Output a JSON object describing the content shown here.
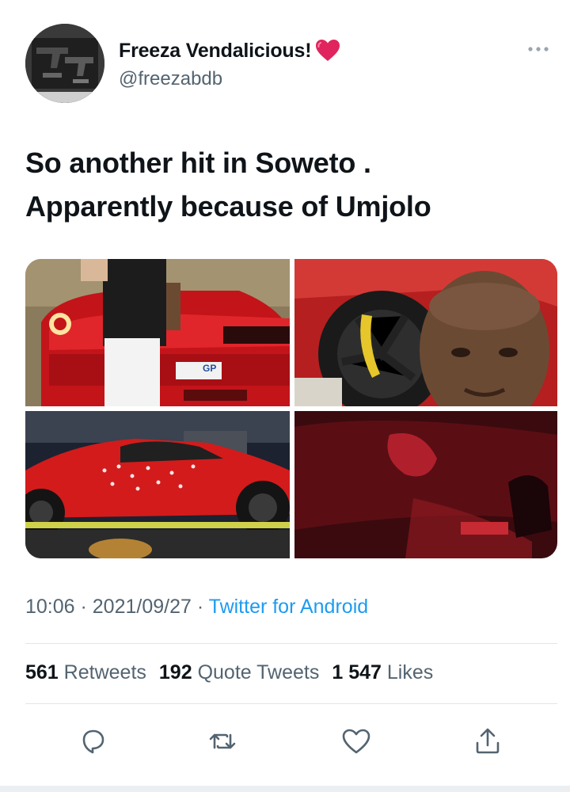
{
  "user": {
    "display_name": "Freeza Vendalicious!",
    "handle": "@freezabdb"
  },
  "tweet": {
    "line1": "So another hit in Soweto .",
    "line2": "Apparently because of Umjolo"
  },
  "media": {
    "plate_text": "GP"
  },
  "meta": {
    "time": "10:06",
    "sep1": " · ",
    "date": "2021/09/27",
    "sep2": " · ",
    "source": "Twitter for Android"
  },
  "stats": {
    "retweets_count": "561",
    "retweets_label": "Retweets",
    "quotes_count": "192",
    "quotes_label": "Quote Tweets",
    "likes_count": "1 547",
    "likes_label": "Likes"
  },
  "icons": {
    "heart": "heart-icon",
    "more": "more-icon",
    "reply": "reply-icon",
    "retweet": "retweet-icon",
    "like": "like-icon",
    "share": "share-icon"
  },
  "colors": {
    "text": "#0f1419",
    "secondary": "#536471",
    "link": "#1d9bf0",
    "heart": "#e0245e",
    "ferrari_red": "#d31b1b"
  }
}
